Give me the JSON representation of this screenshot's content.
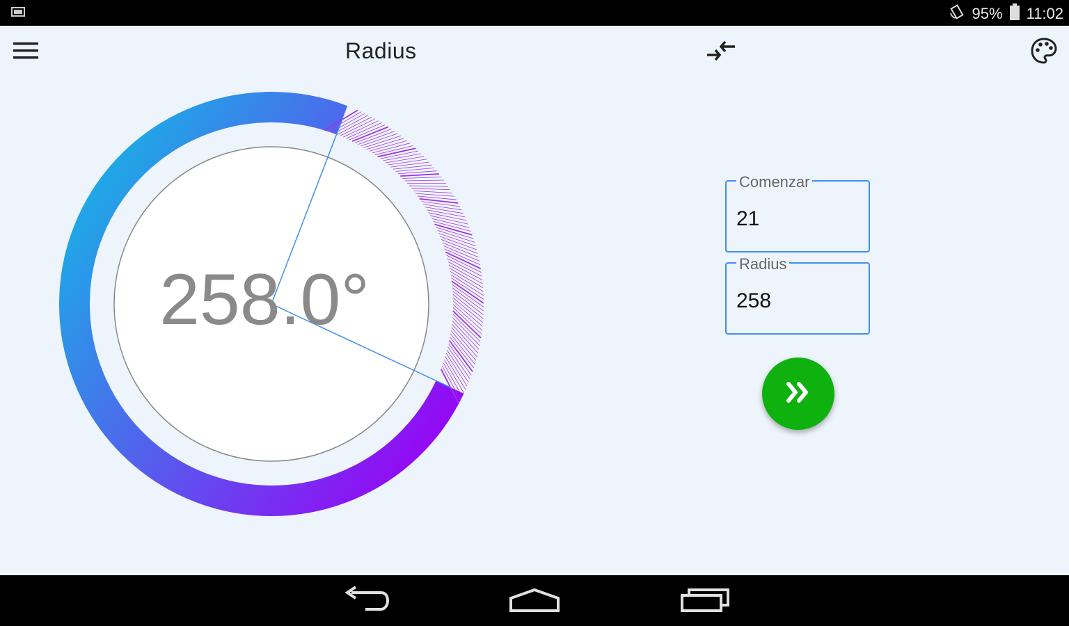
{
  "status_bar": {
    "battery": "95%",
    "time": "11:02",
    "icons": [
      "screenshot-icon",
      "rotation-lock-icon",
      "battery-icon"
    ]
  },
  "app_bar": {
    "title": "Radius",
    "icons": [
      "menu-icon",
      "swap-arrows-icon",
      "palette-icon"
    ]
  },
  "dial": {
    "display_text": "258.0°",
    "start_angle_deg": 21,
    "radius_angle_deg": 258,
    "gradient": {
      "start": "#1aaee6",
      "end": "#9a00f5"
    },
    "hatch_color": "#a032e6",
    "needle_color": "#3d8ff0"
  },
  "form": {
    "start_field": {
      "label": "Comenzar",
      "value": "21"
    },
    "radius_field": {
      "label": "Radius",
      "value": "258"
    },
    "go_button": {
      "icon": "double-chevron-right-icon",
      "color": "#0fb10f"
    }
  },
  "nav_bar": {
    "icons": [
      "back-icon",
      "home-icon",
      "recents-icon"
    ]
  }
}
